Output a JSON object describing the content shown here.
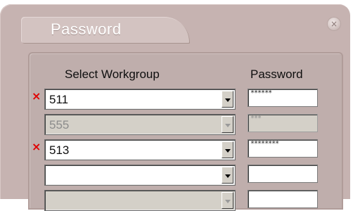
{
  "window": {
    "title": "Password",
    "close_glyph": "×"
  },
  "headers": {
    "workgroup": "Select Workgroup",
    "password": "Password"
  },
  "rows": [
    {
      "value": "511",
      "password_mask": "******",
      "error": "×"
    },
    {
      "value": "555",
      "password_mask": "***",
      "error": ""
    },
    {
      "value": "513",
      "password_mask": "********",
      "error": "×"
    },
    {
      "value": "",
      "password_mask": "",
      "error": ""
    },
    {
      "value": "",
      "password_mask": "",
      "error": ""
    }
  ]
}
